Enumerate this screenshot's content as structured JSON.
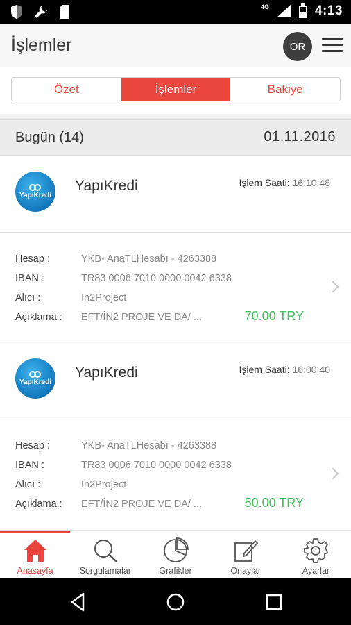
{
  "status_bar": {
    "time": "4:13",
    "network": "4G",
    "icons": [
      "shield-icon",
      "wrench-icon",
      "sd-card-icon",
      "signal-icon",
      "battery-icon"
    ]
  },
  "header": {
    "title": "İşlemler",
    "avatar_initials": "OR",
    "menu_icon": "hamburger-menu-icon"
  },
  "tabs": [
    {
      "label": "Özet",
      "active": false
    },
    {
      "label": "İşlemler",
      "active": true
    },
    {
      "label": "Bakiye",
      "active": false
    }
  ],
  "day": {
    "title": "Bugün (14)",
    "date": "01.11.2016"
  },
  "transactions": [
    {
      "bank": "YapıKredi",
      "logo_text": "YapıKredi",
      "time_label": "İşlem Saati:",
      "time": "16:10:48",
      "hesap_label": "Hesap :",
      "hesap": "YKB- AnaTLHesabı - 4263388",
      "iban_label": "IBAN :",
      "iban": "TR83 0006 7010 0000 0042 6338",
      "alici_label": "Alıcı :",
      "alici": "In2Project",
      "aciklama_label": "Açıklama :",
      "aciklama": "EFT/İN2 PROJE VE DA/ ...",
      "amount": "70.00 TRY"
    },
    {
      "bank": "YapıKredi",
      "logo_text": "YapıKredi",
      "time_label": "İşlem Saati:",
      "time": "16:00:40",
      "hesap_label": "Hesap :",
      "hesap": "YKB- AnaTLHesabı - 4263388",
      "iban_label": "IBAN :",
      "iban": "TR83 0006 7010 0000 0042 6338",
      "alici_label": "Alıcı :",
      "alici": "In2Project",
      "aciklama_label": "Açıklama :",
      "aciklama": "EFT/İN2 PROJE VE DA/ ...",
      "amount": "50.00 TRY"
    }
  ],
  "bottom_nav": [
    {
      "label": "Anasayfa",
      "icon": "home-icon",
      "active": true
    },
    {
      "label": "Sorgulamalar",
      "icon": "search-icon",
      "active": false
    },
    {
      "label": "Grafikler",
      "icon": "pie-chart-icon",
      "active": false
    },
    {
      "label": "Onaylar",
      "icon": "edit-icon",
      "active": false
    },
    {
      "label": "Ayarlar",
      "icon": "gear-icon",
      "active": false
    }
  ],
  "colors": {
    "accent": "#ec473d",
    "amount_green": "#3bc25b",
    "bank_blue": "#0d6fb6"
  }
}
